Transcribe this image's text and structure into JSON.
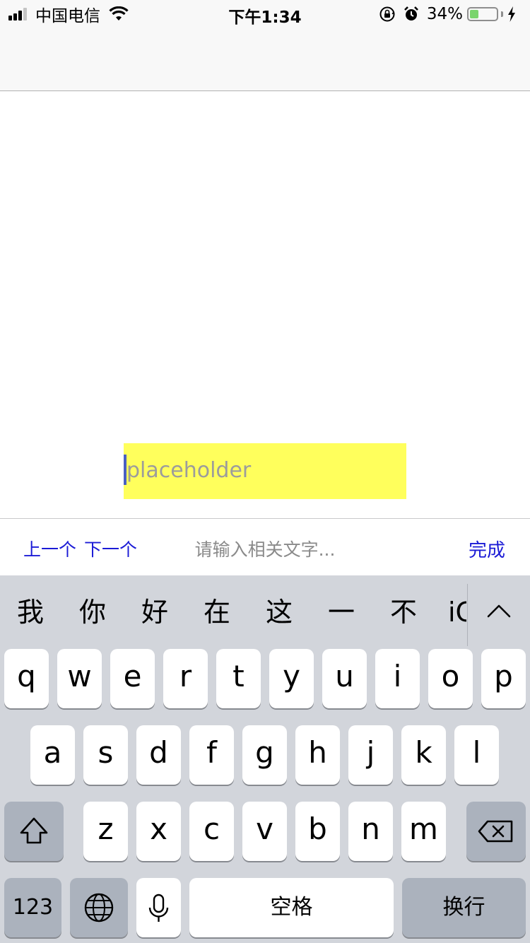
{
  "status_bar": {
    "carrier": "中国电信",
    "time": "下午1:34",
    "battery_percent": "34%",
    "battery_level": 0.34,
    "icons": [
      "signal-icon",
      "wifi-icon",
      "orientation-lock-icon",
      "alarm-icon",
      "battery-icon",
      "charging-icon"
    ]
  },
  "text_field": {
    "placeholder": "placeholder",
    "value": ""
  },
  "accessory_toolbar": {
    "prev_label": "上一个",
    "next_label": "下一个",
    "hint": "请输入相关文字...",
    "done_label": "完成"
  },
  "keyboard": {
    "candidates": [
      "我",
      "你",
      "好",
      "在",
      "这",
      "一",
      "不",
      "iC"
    ],
    "row1": [
      "q",
      "w",
      "e",
      "r",
      "t",
      "y",
      "u",
      "i",
      "o",
      "p"
    ],
    "row2": [
      "a",
      "s",
      "d",
      "f",
      "g",
      "h",
      "j",
      "k",
      "l"
    ],
    "row3": [
      "z",
      "x",
      "c",
      "v",
      "b",
      "n",
      "m"
    ],
    "numbers_label": "123",
    "space_label": "空格",
    "return_label": "换行"
  },
  "colors": {
    "field_background": "#ffff5c",
    "toolbar_link": "#1b1bd6",
    "keyboard_background": "#d2d5db",
    "function_key": "#abb2bd"
  }
}
